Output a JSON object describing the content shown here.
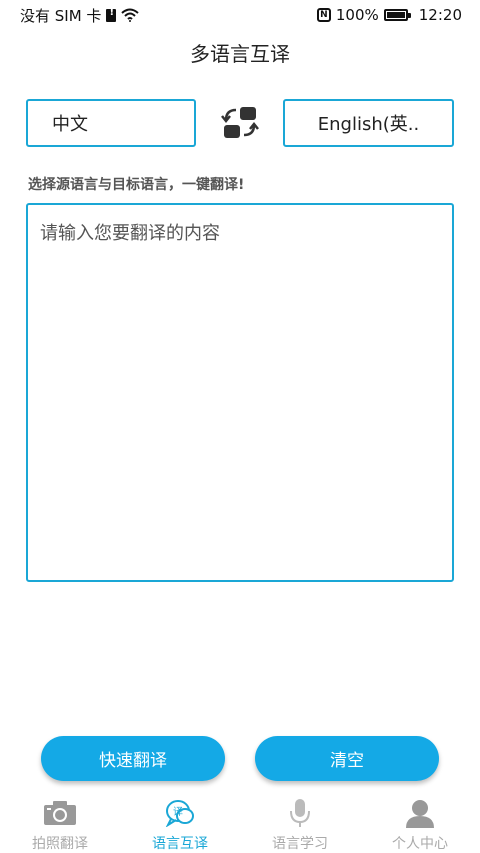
{
  "status_bar": {
    "carrier": "没有 SIM 卡",
    "battery": "100%",
    "time": "12:20"
  },
  "header": {
    "title": "多语言互译"
  },
  "languages": {
    "source": "中文",
    "target": "English(英..",
    "swap_icon": "swap-icon"
  },
  "hint": "选择源语言与目标语言，一键翻译!",
  "input": {
    "placeholder": "请输入您要翻译的内容",
    "value": ""
  },
  "actions": {
    "translate_label": "快速翻译",
    "clear_label": "清空"
  },
  "tabs": [
    {
      "label": "拍照翻译",
      "icon": "camera-icon",
      "active": false
    },
    {
      "label": "语言互译",
      "icon": "translate-icon",
      "active": true
    },
    {
      "label": "语言学习",
      "icon": "microphone-icon",
      "active": false
    },
    {
      "label": "个人中心",
      "icon": "user-icon",
      "active": false
    }
  ],
  "colors": {
    "accent": "#1aa7d6",
    "button": "#14a9e6",
    "inactive": "#aaaaaa"
  }
}
